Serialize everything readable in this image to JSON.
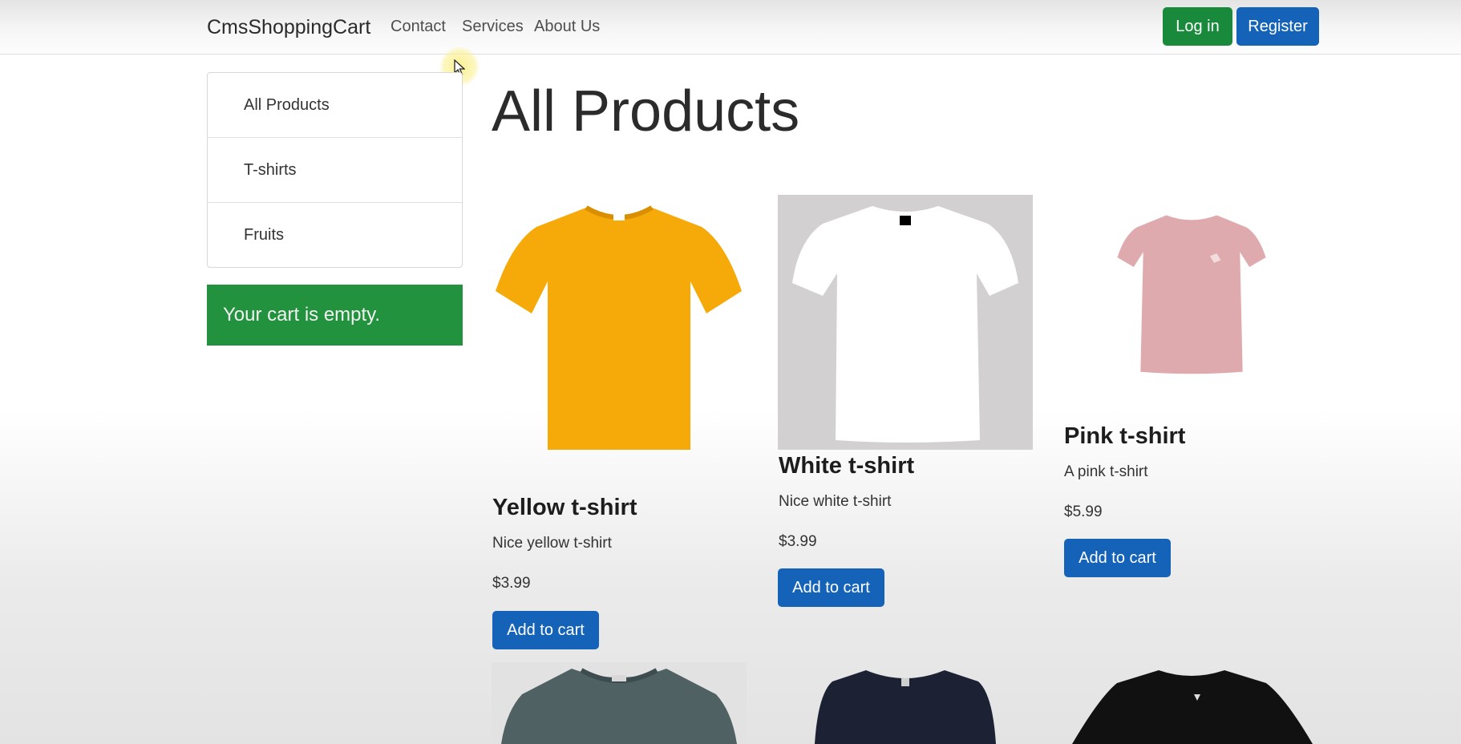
{
  "navbar": {
    "brand": "CmsShoppingCart",
    "links": [
      "Contact",
      "Services",
      "About Us"
    ],
    "login_label": "Log in",
    "register_label": "Register"
  },
  "sidebar": {
    "categories": [
      "All Products",
      "T-shirts",
      "Fruits"
    ],
    "cart_message": "Your cart is empty."
  },
  "main": {
    "title": "All Products",
    "products": [
      {
        "name": "Yellow t-shirt",
        "description": "Nice yellow t-shirt",
        "price": "$3.99",
        "button": "Add to cart",
        "color": "#f5aa0a"
      },
      {
        "name": "White t-shirt",
        "description": "Nice white t-shirt",
        "price": "$3.99",
        "button": "Add to cart",
        "color": "#ffffff"
      },
      {
        "name": "Pink t-shirt",
        "description": "A pink t-shirt",
        "price": "$5.99",
        "button": "Add to cart",
        "color": "#dfaaae"
      }
    ],
    "more_products_colors": [
      "#4f6163",
      "#1c2233",
      "#111111"
    ]
  },
  "colors": {
    "success": "#198a3c",
    "primary": "#1563b8",
    "cart_box": "#23923f"
  }
}
